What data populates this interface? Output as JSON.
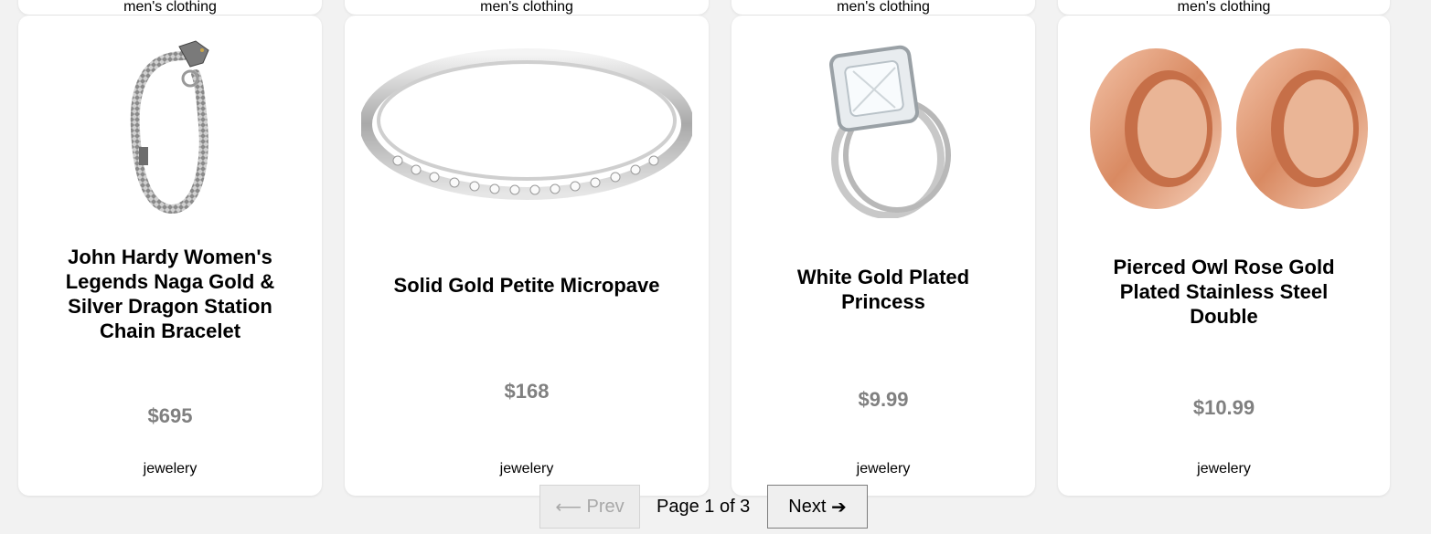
{
  "products_prev_row": [
    {
      "category": "men's clothing"
    },
    {
      "category": "men's clothing"
    },
    {
      "category": "men's clothing"
    },
    {
      "category": "men's clothing"
    }
  ],
  "products": [
    {
      "title": "John Hardy Women's Legends Naga Gold & Silver Dragon Station Chain Bracelet",
      "price": "$695",
      "category": "jewelery",
      "image": "silver-dragon-bracelet"
    },
    {
      "title": "Solid Gold Petite Micropave",
      "price": "$168",
      "category": "jewelery",
      "image": "diamond-band-ring"
    },
    {
      "title": "White Gold Plated Princess",
      "price": "$9.99",
      "category": "jewelery",
      "image": "princess-cut-ring-set"
    },
    {
      "title": "Pierced Owl Rose Gold Plated Stainless Steel Double",
      "price": "$10.99",
      "category": "jewelery",
      "image": "rose-gold-tunnel-plugs"
    }
  ],
  "pagination": {
    "prev_label": "Prev",
    "next_label": "Next",
    "page_info": "Page 1 of 3",
    "prev_arrow": "⟵",
    "next_arrow": "➔"
  }
}
